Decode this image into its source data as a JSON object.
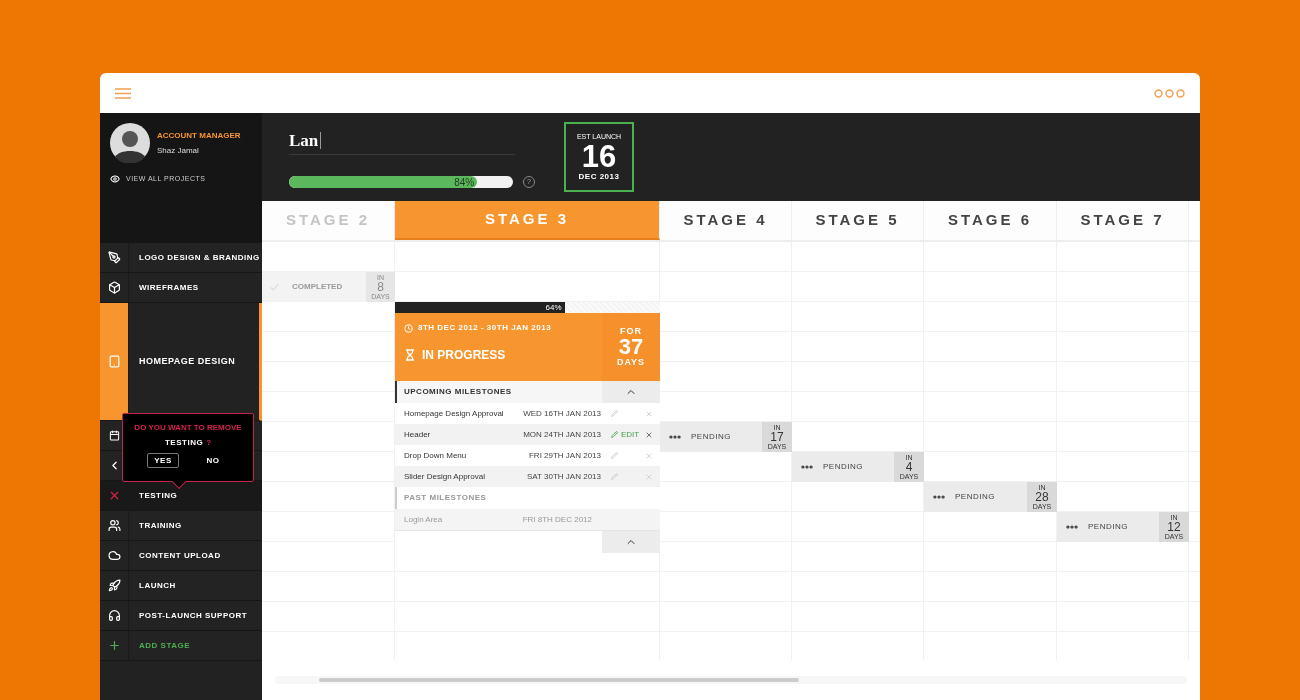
{
  "profile": {
    "role": "ACCOUNT MANAGER",
    "name": "Shaz Jamal",
    "link": "VIEW ALL PROJECTS"
  },
  "sidebar": {
    "items": [
      {
        "label": "LOGO DESIGN & BRANDING",
        "selected": false,
        "removing": false,
        "kind": "stage"
      },
      {
        "label": "WIREFRAMES",
        "selected": false,
        "removing": false,
        "kind": "stage"
      },
      {
        "label": "HOMEPAGE DESIGN",
        "selected": true,
        "removing": false,
        "kind": "stage"
      },
      {
        "selected": false,
        "removing": false,
        "kind": "stage"
      },
      {
        "selected": false,
        "removing": false,
        "kind": "stage"
      },
      {
        "label": "TESTING",
        "selected": false,
        "removing": true,
        "kind": "stage"
      },
      {
        "label": "TRAINING",
        "selected": false,
        "removing": false,
        "kind": "stage"
      },
      {
        "label": "CONTENT UPLOAD",
        "selected": false,
        "removing": false,
        "kind": "stage"
      },
      {
        "label": "LAUNCH",
        "selected": false,
        "removing": false,
        "kind": "stage"
      },
      {
        "label": "POST-LAUNCH SUPPORT",
        "selected": false,
        "removing": false,
        "kind": "stage"
      },
      {
        "label": "ADD STAGE",
        "selected": false,
        "removing": false,
        "kind": "add"
      }
    ]
  },
  "confirm": {
    "question": "DO YOU WANT TO REMOVE",
    "subject": "TESTING",
    "mark": "?",
    "buttons": [
      {
        "label": "YES",
        "selected": true
      },
      {
        "label": "NO",
        "selected": false
      }
    ]
  },
  "header": {
    "project_name": "Lan",
    "progress": {
      "level": 0.84,
      "reading": "84%"
    },
    "help": "?",
    "launch": {
      "label": "EST LAUNCH",
      "day": "16",
      "month": "DEC 2013"
    }
  },
  "stages": [
    {
      "label": "STAGE 2",
      "selected": false,
      "kind": "completed",
      "bar": {
        "label": "COMPLETED",
        "prefix": "IN",
        "days": "8",
        "unit": "DAYS"
      }
    },
    {
      "label": "STAGE 3",
      "selected": true,
      "kind": "current",
      "card": {
        "progress": {
          "level": 0.64,
          "reading": "64%"
        },
        "dates": "8TH DEC 2012 - 30TH JAN 2013",
        "status": "IN PROGRESS",
        "prefix": "FOR",
        "days": "37",
        "unit": "DAYS",
        "upcoming": {
          "heading": "UPCOMING MILESTONES",
          "items": [
            {
              "name": "Homepage Design Approval",
              "date": "WED 16TH JAN 2013",
              "editing": false
            },
            {
              "name": "Header",
              "date": "MON 24TH JAN 2013",
              "editing": true,
              "action": "EDIT"
            },
            {
              "name": "Drop Down Menu",
              "date": "FRI 29TH JAN 2013",
              "editing": false
            },
            {
              "name": "Slider Design Approval",
              "date": "SAT 30TH JAN 2013",
              "editing": false
            }
          ]
        },
        "past": {
          "heading": "PAST MILESTONES",
          "items": [
            {
              "name": "Login Area",
              "date": "FRI 8TH DEC 2012"
            }
          ]
        }
      }
    },
    {
      "label": "STAGE 4",
      "selected": false,
      "kind": "pending",
      "bar": {
        "label": "PENDING",
        "prefix": "IN",
        "days": "17",
        "unit": "DAYS"
      }
    },
    {
      "label": "STAGE 5",
      "selected": false,
      "kind": "pending",
      "bar": {
        "label": "PENDING",
        "prefix": "IN",
        "days": "4",
        "unit": "DAYS"
      }
    },
    {
      "label": "STAGE 6",
      "selected": false,
      "kind": "pending",
      "bar": {
        "label": "PENDING",
        "prefix": "IN",
        "days": "28",
        "unit": "DAYS"
      }
    },
    {
      "label": "STAGE 7",
      "selected": false,
      "kind": "pending",
      "bar": {
        "label": "PENDING",
        "prefix": "IN",
        "days": "12",
        "unit": "DAYS"
      }
    }
  ]
}
